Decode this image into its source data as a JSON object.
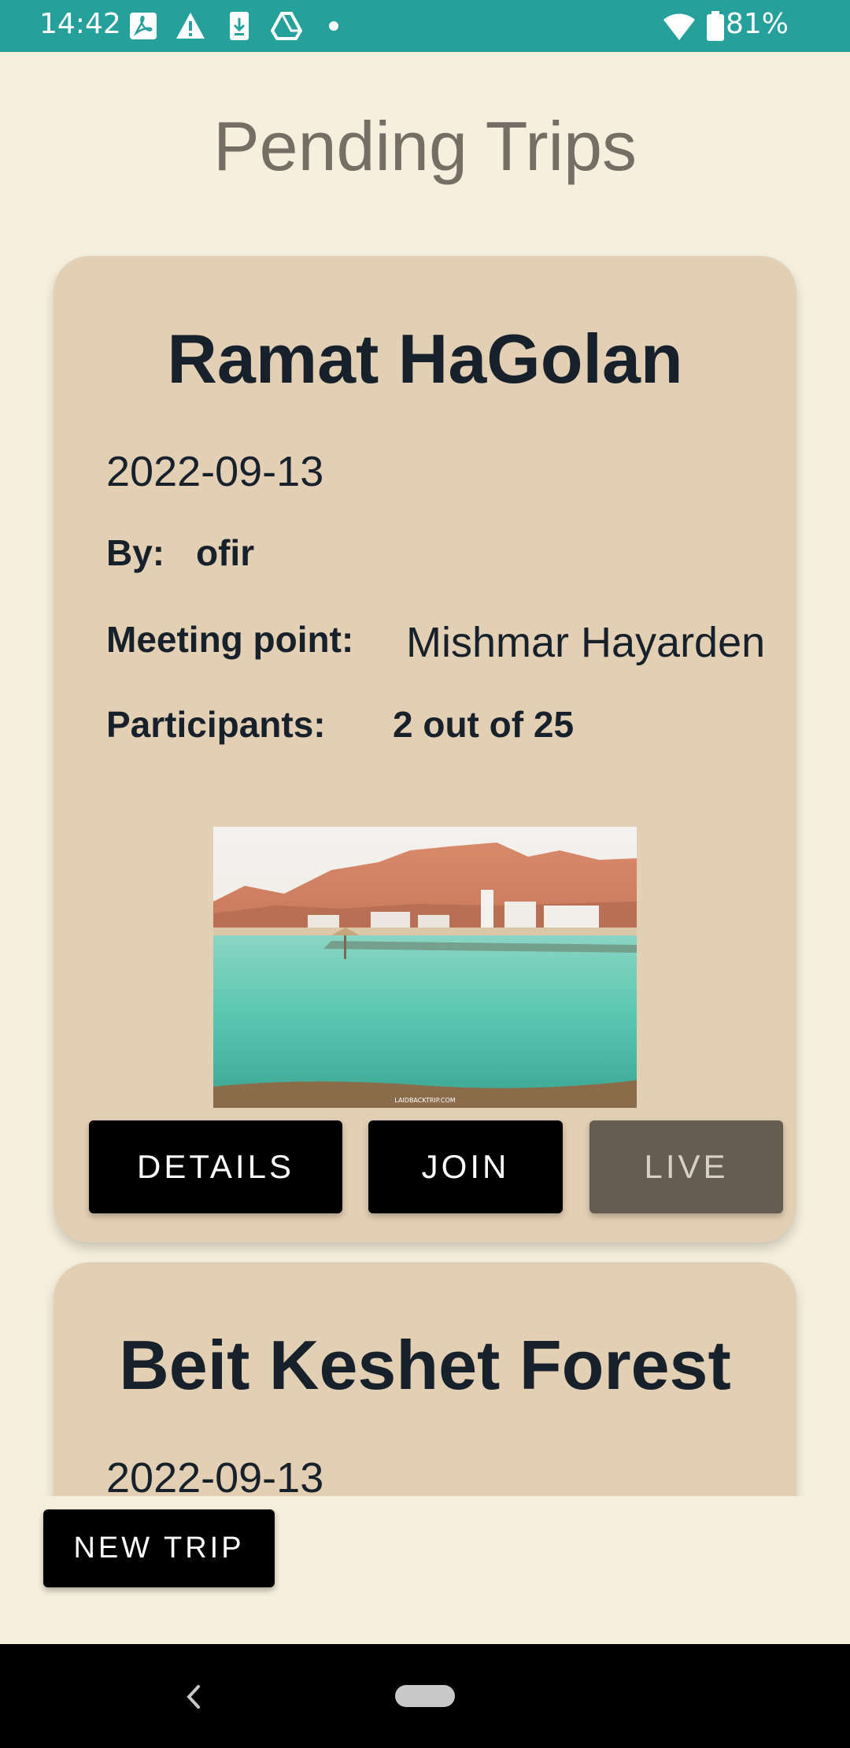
{
  "status_bar": {
    "time": "14:42",
    "battery": "81%",
    "icons": [
      "pdf-icon",
      "warning-icon",
      "download-icon",
      "drive-icon",
      "dot-icon",
      "wifi-icon",
      "battery-icon"
    ]
  },
  "page": {
    "title": "Pending Trips"
  },
  "trips": [
    {
      "title": "Ramat HaGolan",
      "date": "2022-09-13",
      "by_label": "By:",
      "by_value": "ofir",
      "meeting_label": "Meeting point:",
      "meeting_value": "Mishmar Hayarden",
      "participants_label": "Participants:",
      "participants_value": "2 out of 25",
      "image_watermark": "LAIDBACKTRIP.COM",
      "buttons": {
        "details": "DETAILS",
        "join": "JOIN",
        "live": "LIVE"
      }
    },
    {
      "title": "Beit Keshet Forest",
      "date": "2022-09-13"
    }
  ],
  "actions": {
    "new_trip": "NEW TRIP"
  },
  "colors": {
    "status_bar": "#25a09b",
    "background": "#f6efdd",
    "card": "#e3cfb4",
    "button": "#000000",
    "button_disabled": "#655d52"
  }
}
